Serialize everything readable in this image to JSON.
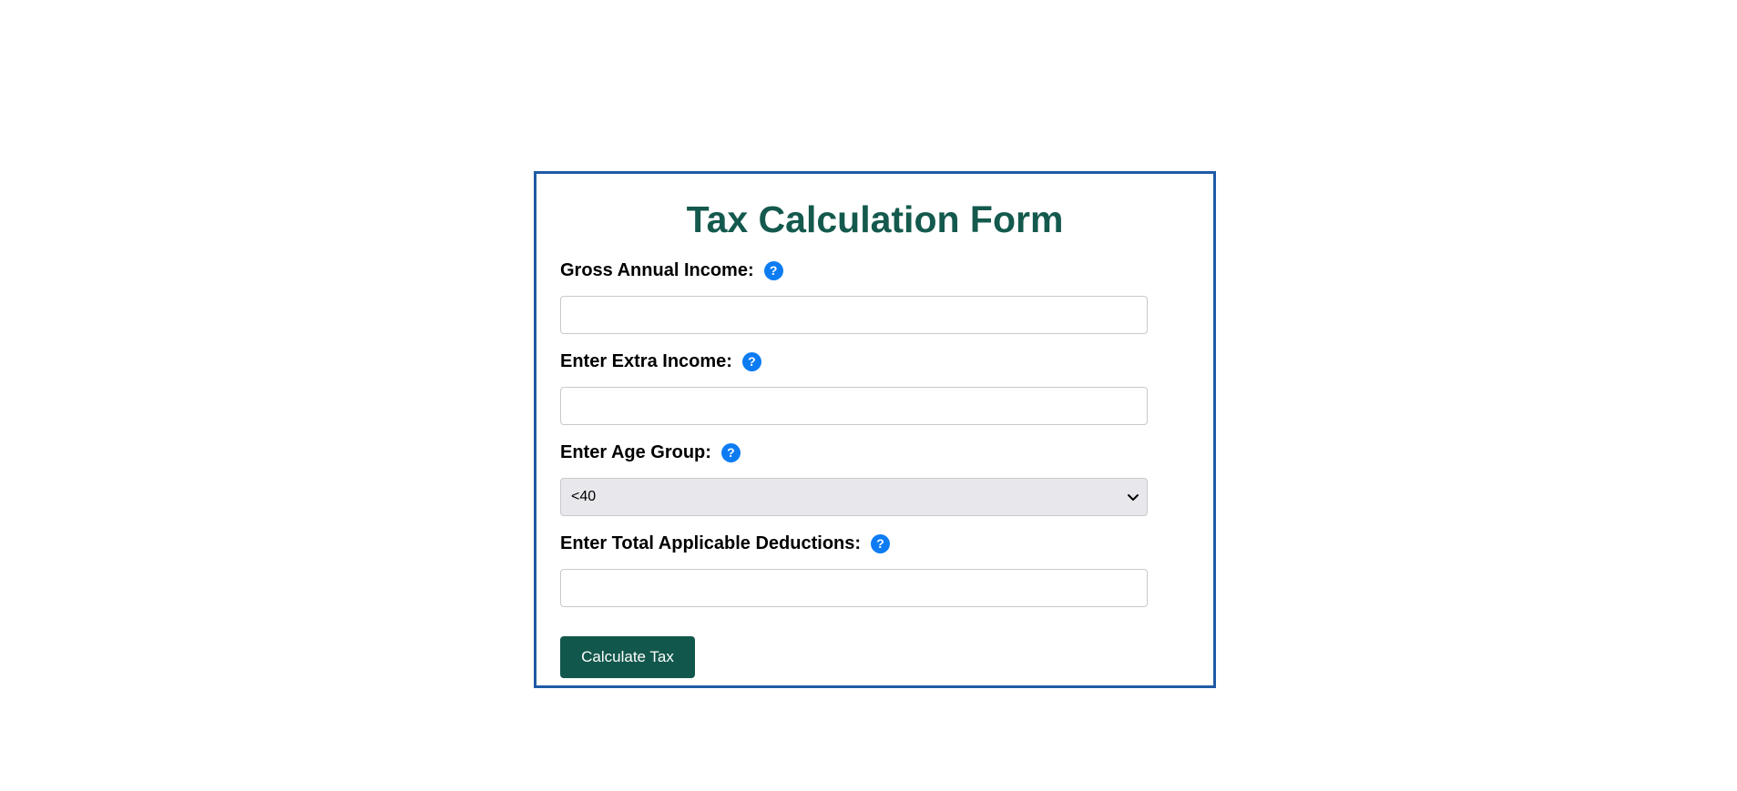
{
  "form": {
    "title": "Tax Calculation Form",
    "fields": [
      {
        "label": "Gross Annual Income:",
        "value": "",
        "placeholder": "",
        "help": "?"
      },
      {
        "label": "Enter Extra Income:",
        "value": "",
        "placeholder": "",
        "help": "?"
      },
      {
        "label": "Enter Age Group:",
        "selected": "<40",
        "help": "?"
      },
      {
        "label": "Enter Total Applicable Deductions:",
        "value": "",
        "placeholder": "",
        "help": "?"
      }
    ],
    "submit_label": "Calculate Tax"
  },
  "colors": {
    "title": "#14594d",
    "border": "#1f5aa6",
    "help_icon": "#0d7cf2",
    "button": "#12574b",
    "select_bg": "#e8e8ec"
  },
  "icons": {
    "help": "question-circle-icon",
    "select_arrow": "chevron-down-icon"
  }
}
